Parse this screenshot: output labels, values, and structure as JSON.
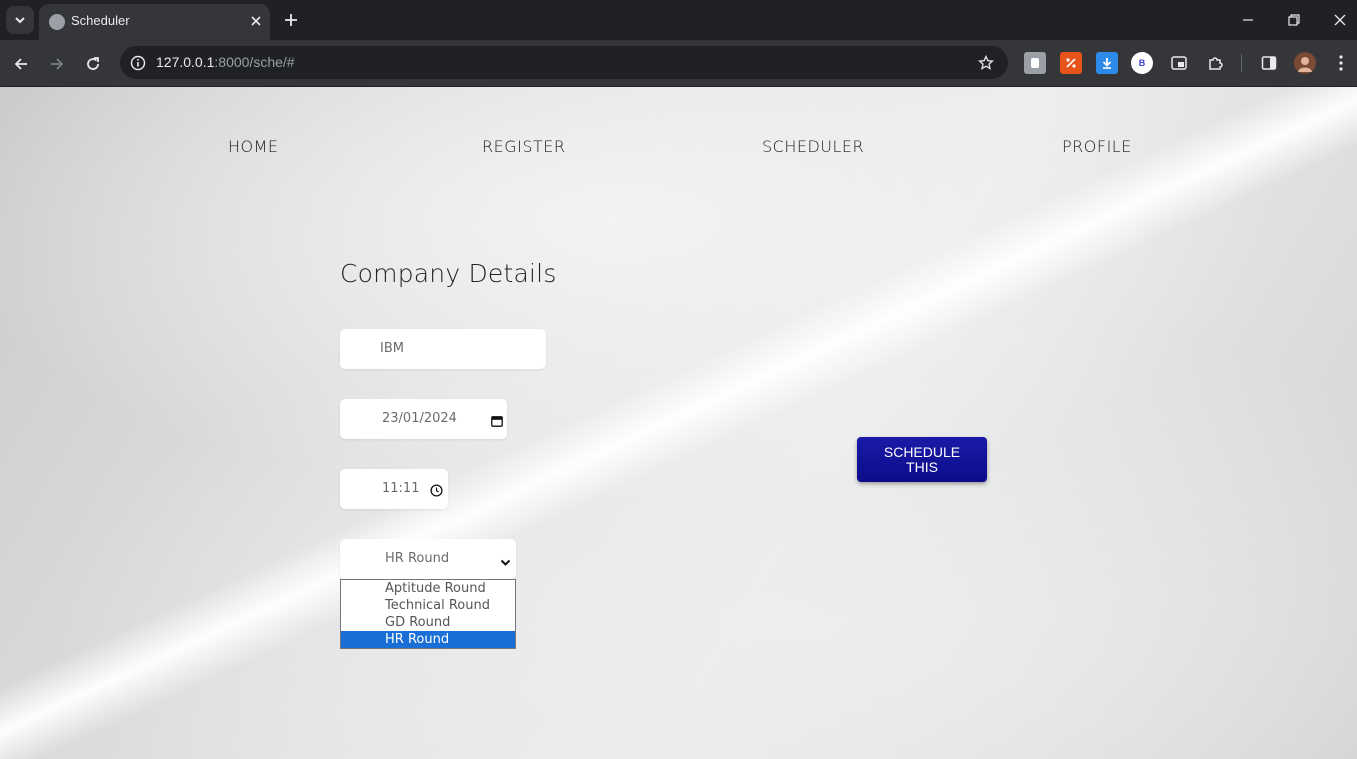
{
  "browser": {
    "tab_title": "Scheduler",
    "url_host": "127.0.0.1",
    "url_path": ":8000/sche/#",
    "profile_badge": "B"
  },
  "nav": {
    "home": "HOME",
    "register": "REGISTER",
    "scheduler": "SCHEDULER",
    "profile": "PROFILE"
  },
  "form": {
    "title": "Company Details",
    "company_value": "IBM",
    "date_value": "23/01/2024",
    "time_value": "11:11",
    "round_value": "HR Round",
    "round_options": [
      "Aptitude Round",
      "Technical Round",
      "GD Round",
      "HR Round"
    ],
    "selected_option_index": 3,
    "submit_label": "SCHEDULE THIS"
  },
  "colors": {
    "button": "#0c0c8a",
    "selected_option": "#1a6fd6"
  }
}
